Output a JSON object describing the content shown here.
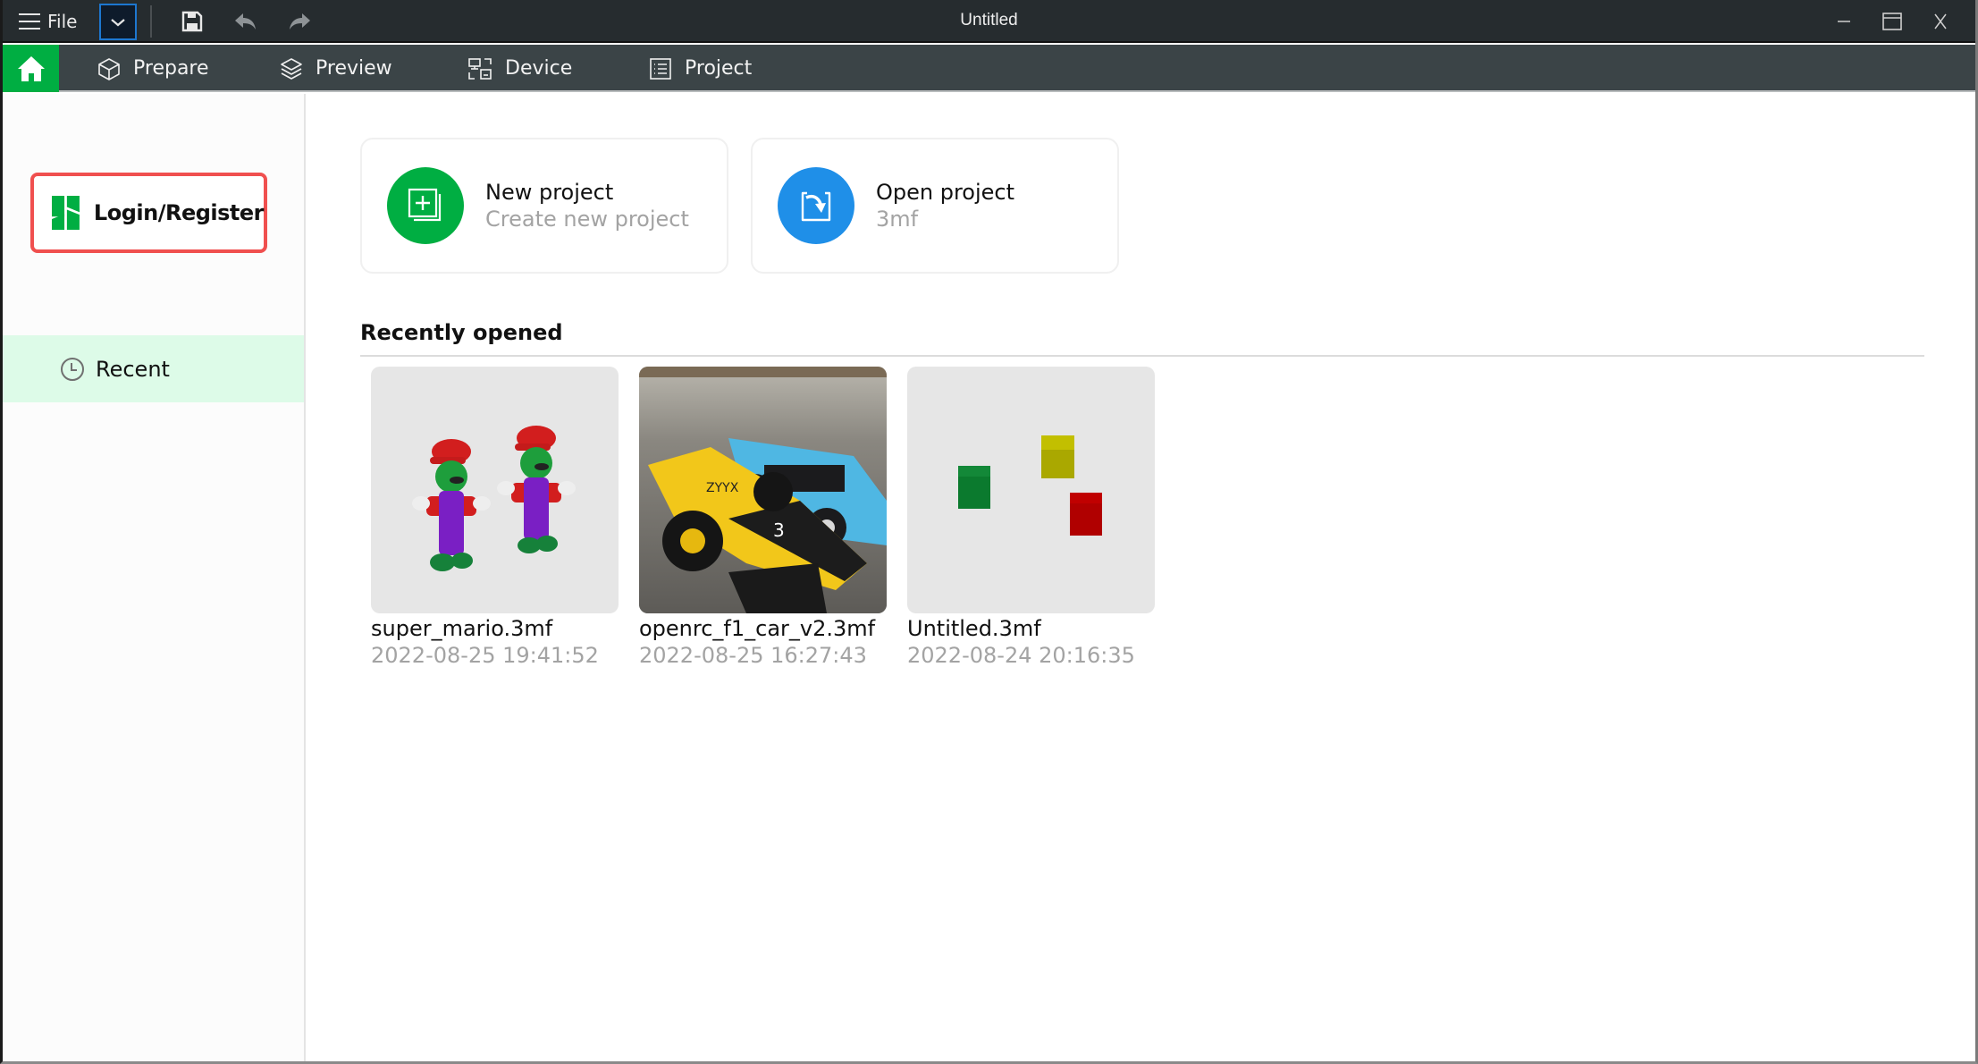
{
  "titlebar": {
    "file_label": "File",
    "window_title": "Untitled",
    "icons": {
      "menu": "hamburger-icon",
      "dropdown": "chevron-down-icon",
      "save": "floppy-disk-icon",
      "undo": "undo-arrow-icon",
      "redo": "redo-arrow-icon",
      "minimize": "minimize-icon",
      "maximize": "maximize-icon",
      "close": "close-icon"
    }
  },
  "menubar": {
    "home_icon": "home-icon",
    "items": [
      {
        "label": "Prepare",
        "icon": "cube-icon"
      },
      {
        "label": "Preview",
        "icon": "layers-icon"
      },
      {
        "label": "Device",
        "icon": "device-icon"
      },
      {
        "label": "Project",
        "icon": "list-icon"
      }
    ]
  },
  "sidebar": {
    "login_label": "Login/Register",
    "login_icon": "bambu-logo-icon",
    "items": [
      {
        "label": "Recent",
        "icon": "clock-icon",
        "selected": true
      }
    ]
  },
  "actions": [
    {
      "title": "New project",
      "subtitle": "Create new project",
      "icon": "new-project-icon",
      "color": "#00ae42"
    },
    {
      "title": "Open project",
      "subtitle": "3mf",
      "icon": "open-project-icon",
      "color": "#1f8fe8"
    }
  ],
  "recent": {
    "heading": "Recently opened",
    "files": [
      {
        "name": "super_mario.3mf",
        "date": "2022-08-25 19:41:52",
        "thumbnail": "mario-models"
      },
      {
        "name": "openrc_f1_car_v2.3mf",
        "date": "2022-08-25 16:27:43",
        "thumbnail": "f1-car-photo"
      },
      {
        "name": "Untitled.3mf",
        "date": "2022-08-24 20:16:35",
        "thumbnail": "colored-blocks"
      }
    ]
  },
  "colors": {
    "accent_green": "#00ae42",
    "accent_blue": "#1f8fe8",
    "highlight_red": "#f0504f",
    "selected_bg": "#ddfbe8",
    "titlebar_bg": "#262c2f",
    "menubar_bg": "#3b4447"
  }
}
